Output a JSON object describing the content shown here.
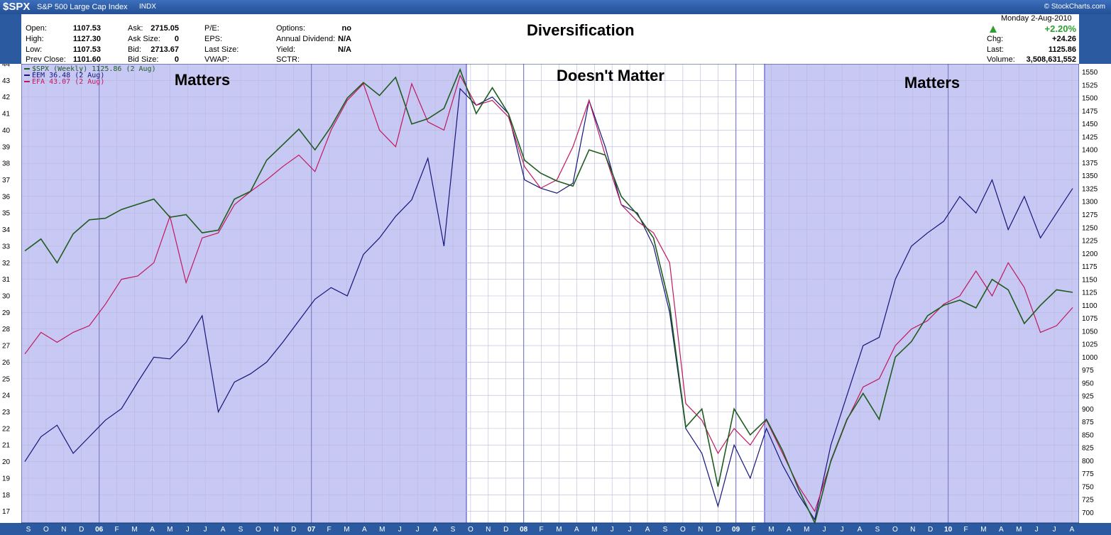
{
  "topbar": {
    "symbol": "$SPX",
    "name": "S&P 500 Large Cap Index",
    "exchange": "INDX",
    "brand": "© StockCharts.com"
  },
  "header": {
    "title": "Diversification",
    "date": "Monday  2-Aug-2010",
    "pct_change": "+2.20%",
    "stats": [
      {
        "label": "Open:",
        "value": "1107.53"
      },
      {
        "label": "High:",
        "value": "1127.30"
      },
      {
        "label": "Low:",
        "value": "1107.53"
      },
      {
        "label": "Prev Close:",
        "value": "1101.60"
      },
      {
        "label": "Ask:",
        "value": "2715.05"
      },
      {
        "label": "Ask Size:",
        "value": "0"
      },
      {
        "label": "Bid:",
        "value": "2713.67"
      },
      {
        "label": "Bid Size:",
        "value": "0"
      },
      {
        "label": "P/E:",
        "value": ""
      },
      {
        "label": "EPS:",
        "value": ""
      },
      {
        "label": "Last Size:",
        "value": ""
      },
      {
        "label": "VWAP:",
        "value": ""
      },
      {
        "label": "Options:",
        "value": "no"
      },
      {
        "label": "Annual Dividend:",
        "value": "N/A"
      },
      {
        "label": "Yield:",
        "value": "N/A"
      },
      {
        "label": "SCTR:",
        "value": ""
      },
      {
        "label": "Chg:",
        "value": "+24.26"
      },
      {
        "label": "Last:",
        "value": "1125.86"
      },
      {
        "label": "Volume:",
        "value": "3,508,631,552"
      }
    ]
  },
  "colors": {
    "spx": "#1e5c1e",
    "eem": "#15157a",
    "efa": "#c0185e",
    "shade": "#c8c8f5",
    "frame": "#2c5aa0",
    "up_arrow": "#2e9e2e"
  },
  "chart_data": {
    "type": "line",
    "title": "Diversification",
    "x_labels": [
      "S",
      "O",
      "N",
      "D",
      "06",
      "F",
      "M",
      "A",
      "M",
      "J",
      "J",
      "A",
      "S",
      "O",
      "N",
      "D",
      "07",
      "F",
      "M",
      "A",
      "M",
      "J",
      "J",
      "A",
      "S",
      "O",
      "N",
      "D",
      "08",
      "F",
      "M",
      "A",
      "M",
      "J",
      "J",
      "A",
      "S",
      "O",
      "N",
      "D",
      "09",
      "F",
      "M",
      "A",
      "M",
      "J",
      "J",
      "A",
      "S",
      "O",
      "N",
      "D",
      "10",
      "F",
      "M",
      "A",
      "M",
      "J",
      "J",
      "A"
    ],
    "left_axis": {
      "min": 16.3,
      "max": 44.0,
      "ticks": [
        17,
        18,
        19,
        20,
        21,
        22,
        23,
        24,
        25,
        26,
        27,
        28,
        29,
        30,
        31,
        32,
        33,
        34,
        35,
        36,
        37,
        38,
        39,
        40,
        41,
        42,
        43,
        44
      ]
    },
    "right_axis": {
      "min": 680,
      "max": 1566,
      "ticks": [
        700,
        725,
        750,
        775,
        800,
        825,
        850,
        875,
        900,
        925,
        950,
        975,
        1000,
        1025,
        1050,
        1075,
        1100,
        1125,
        1150,
        1175,
        1200,
        1225,
        1250,
        1275,
        1300,
        1325,
        1350,
        1375,
        1400,
        1425,
        1450,
        1475,
        1500,
        1525,
        1550
      ]
    },
    "regions": [
      {
        "label": "Matters",
        "from": "S 2005",
        "to": "O 2007",
        "shaded": true
      },
      {
        "label": "Doesn't Matter",
        "from": "O 2007",
        "to": "M 2009",
        "shaded": false
      },
      {
        "label": "Matters",
        "from": "M 2009",
        "to": "A 2010",
        "shaded": true
      }
    ],
    "series": [
      {
        "name": "$SPX (Weekly) 1125.86 (2 Aug)",
        "axis": "right",
        "points": [
          [
            0,
            1205
          ],
          [
            1,
            1228
          ],
          [
            2,
            1182
          ],
          [
            3,
            1238
          ],
          [
            4,
            1265
          ],
          [
            5,
            1268
          ],
          [
            6,
            1285
          ],
          [
            7,
            1295
          ],
          [
            8,
            1305
          ],
          [
            9,
            1270
          ],
          [
            10,
            1275
          ],
          [
            11,
            1240
          ],
          [
            12,
            1245
          ],
          [
            13,
            1305
          ],
          [
            14,
            1320
          ],
          [
            15,
            1380
          ],
          [
            16,
            1410
          ],
          [
            17,
            1440
          ],
          [
            18,
            1400
          ],
          [
            19,
            1445
          ],
          [
            20,
            1500
          ],
          [
            21,
            1530
          ],
          [
            22,
            1505
          ],
          [
            23,
            1540
          ],
          [
            24,
            1450
          ],
          [
            25,
            1460
          ],
          [
            26,
            1480
          ],
          [
            27,
            1555
          ],
          [
            28,
            1470
          ],
          [
            29,
            1520
          ],
          [
            30,
            1470
          ],
          [
            31,
            1380
          ],
          [
            32,
            1355
          ],
          [
            33,
            1340
          ],
          [
            34,
            1330
          ],
          [
            35,
            1400
          ],
          [
            36,
            1390
          ],
          [
            37,
            1310
          ],
          [
            38,
            1275
          ],
          [
            39,
            1230
          ],
          [
            40,
            1100
          ],
          [
            41,
            865
          ],
          [
            42,
            900
          ],
          [
            43,
            750
          ],
          [
            44,
            900
          ],
          [
            45,
            850
          ],
          [
            46,
            880
          ],
          [
            47,
            820
          ],
          [
            48,
            745
          ],
          [
            49,
            680
          ],
          [
            50,
            800
          ],
          [
            51,
            880
          ],
          [
            52,
            930
          ],
          [
            53,
            880
          ],
          [
            54,
            1000
          ],
          [
            55,
            1030
          ],
          [
            56,
            1080
          ],
          [
            57,
            1100
          ],
          [
            58,
            1110
          ],
          [
            59,
            1095
          ],
          [
            60,
            1150
          ],
          [
            61,
            1130
          ],
          [
            62,
            1065
          ],
          [
            63,
            1100
          ],
          [
            64,
            1130
          ],
          [
            65,
            1125
          ]
        ]
      },
      {
        "name": "EEM 36.48 (2 Aug)",
        "axis": "left",
        "points": [
          [
            0,
            20.0
          ],
          [
            1,
            21.5
          ],
          [
            2,
            22.2
          ],
          [
            3,
            20.5
          ],
          [
            4,
            21.5
          ],
          [
            5,
            22.5
          ],
          [
            6,
            23.2
          ],
          [
            7,
            24.8
          ],
          [
            8,
            26.3
          ],
          [
            9,
            26.2
          ],
          [
            10,
            27.2
          ],
          [
            11,
            28.8
          ],
          [
            12,
            23.0
          ],
          [
            13,
            24.8
          ],
          [
            14,
            25.3
          ],
          [
            15,
            26.0
          ],
          [
            16,
            27.2
          ],
          [
            17,
            28.5
          ],
          [
            18,
            29.8
          ],
          [
            19,
            30.5
          ],
          [
            20,
            30.0
          ],
          [
            21,
            32.5
          ],
          [
            22,
            33.5
          ],
          [
            23,
            34.8
          ],
          [
            24,
            35.8
          ],
          [
            25,
            38.3
          ],
          [
            26,
            33.0
          ],
          [
            27,
            42.5
          ],
          [
            28,
            41.5
          ],
          [
            29,
            42.0
          ],
          [
            30,
            41.0
          ],
          [
            31,
            37.0
          ],
          [
            32,
            36.5
          ],
          [
            33,
            36.2
          ],
          [
            34,
            36.8
          ],
          [
            35,
            41.8
          ],
          [
            36,
            39.0
          ],
          [
            37,
            35.5
          ],
          [
            38,
            35.0
          ],
          [
            39,
            33.0
          ],
          [
            40,
            29.0
          ],
          [
            41,
            22.0
          ],
          [
            42,
            20.5
          ],
          [
            43,
            17.3
          ],
          [
            44,
            21.0
          ],
          [
            45,
            19.0
          ],
          [
            46,
            22.0
          ],
          [
            47,
            19.8
          ],
          [
            48,
            18.0
          ],
          [
            49,
            16.5
          ],
          [
            50,
            21.0
          ],
          [
            51,
            24.0
          ],
          [
            52,
            27.0
          ],
          [
            53,
            27.5
          ],
          [
            54,
            31.0
          ],
          [
            55,
            33.0
          ],
          [
            56,
            33.8
          ],
          [
            57,
            34.5
          ],
          [
            58,
            36.0
          ],
          [
            59,
            35.0
          ],
          [
            60,
            37.0
          ],
          [
            61,
            34.0
          ],
          [
            62,
            36.0
          ],
          [
            63,
            33.5
          ],
          [
            64,
            35.0
          ],
          [
            65,
            36.48
          ]
        ]
      },
      {
        "name": "EFA 43.07 (2 Aug)",
        "axis": "left",
        "points": [
          [
            0,
            26.5
          ],
          [
            1,
            27.8
          ],
          [
            2,
            27.2
          ],
          [
            3,
            27.8
          ],
          [
            4,
            28.2
          ],
          [
            5,
            29.5
          ],
          [
            6,
            31.0
          ],
          [
            7,
            31.2
          ],
          [
            8,
            32.0
          ],
          [
            9,
            34.8
          ],
          [
            10,
            30.8
          ],
          [
            11,
            33.5
          ],
          [
            12,
            33.8
          ],
          [
            13,
            35.5
          ],
          [
            14,
            36.3
          ],
          [
            15,
            37.0
          ],
          [
            16,
            37.8
          ],
          [
            17,
            38.5
          ],
          [
            18,
            37.5
          ],
          [
            19,
            40.0
          ],
          [
            20,
            41.8
          ],
          [
            21,
            42.8
          ],
          [
            22,
            40.0
          ],
          [
            23,
            39.0
          ],
          [
            24,
            42.8
          ],
          [
            25,
            40.5
          ],
          [
            26,
            40.0
          ],
          [
            27,
            43.3
          ],
          [
            28,
            41.5
          ],
          [
            29,
            41.8
          ],
          [
            30,
            40.8
          ],
          [
            31,
            37.8
          ],
          [
            32,
            36.5
          ],
          [
            33,
            37.0
          ],
          [
            34,
            39.0
          ],
          [
            35,
            41.8
          ],
          [
            36,
            38.5
          ],
          [
            37,
            35.5
          ],
          [
            38,
            34.5
          ],
          [
            39,
            33.8
          ],
          [
            40,
            32.0
          ],
          [
            41,
            23.5
          ],
          [
            42,
            22.5
          ],
          [
            43,
            20.5
          ],
          [
            44,
            22.0
          ],
          [
            45,
            21.0
          ],
          [
            46,
            22.5
          ],
          [
            47,
            20.5
          ],
          [
            48,
            18.5
          ],
          [
            49,
            17.0
          ],
          [
            50,
            20.0
          ],
          [
            51,
            22.5
          ],
          [
            52,
            24.5
          ],
          [
            53,
            25.0
          ],
          [
            54,
            27.0
          ],
          [
            55,
            28.0
          ],
          [
            56,
            28.5
          ],
          [
            57,
            29.5
          ],
          [
            58,
            30.0
          ],
          [
            59,
            31.5
          ],
          [
            60,
            30.0
          ],
          [
            61,
            32.0
          ],
          [
            62,
            30.5
          ],
          [
            63,
            27.8
          ],
          [
            64,
            28.2
          ],
          [
            65,
            29.3
          ]
        ]
      }
    ],
    "legend": {
      "placement": "top-left"
    }
  }
}
